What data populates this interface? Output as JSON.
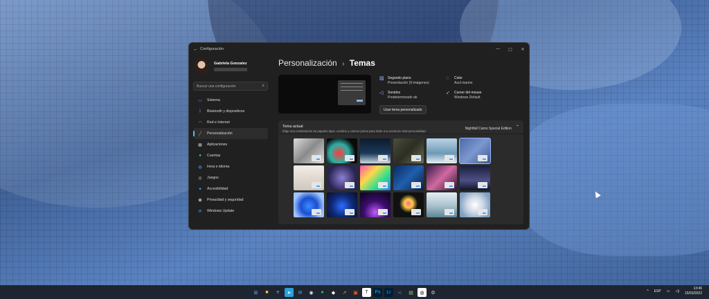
{
  "window": {
    "title": "Configuración",
    "controls": [
      "—",
      "▢",
      "✕"
    ]
  },
  "profile": {
    "name": "Gabriela Gonzalez"
  },
  "search": {
    "placeholder": "Buscar una configuración"
  },
  "sidebar": {
    "items": [
      {
        "label": "Sistema",
        "icon": "monitor-icon",
        "color": "#4aa8ff"
      },
      {
        "label": "Bluetooth y dispositivos",
        "icon": "bluetooth-icon",
        "color": "#4aa8ff"
      },
      {
        "label": "Red e Internet",
        "icon": "wifi-icon",
        "color": "#7aa6ff"
      },
      {
        "label": "Personalización",
        "icon": "brush-icon",
        "color": "#ff8c5a",
        "active": true
      },
      {
        "label": "Aplicaciones",
        "icon": "apps-icon",
        "color": "#c0c0c0"
      },
      {
        "label": "Cuentas",
        "icon": "person-icon",
        "color": "#3fcf8e"
      },
      {
        "label": "Hora e idioma",
        "icon": "globe-icon",
        "color": "#4aa8ff"
      },
      {
        "label": "Juegos",
        "icon": "gamepad-icon",
        "color": "#c0c0c0"
      },
      {
        "label": "Accesibilidad",
        "icon": "accessibility-icon",
        "color": "#4aa8ff"
      },
      {
        "label": "Privacidad y seguridad",
        "icon": "shield-icon",
        "color": "#9aa0a6"
      },
      {
        "label": "Windows Update",
        "icon": "update-icon",
        "color": "#4aa8ff"
      }
    ]
  },
  "breadcrumb": {
    "parent": "Personalización",
    "separator": "›",
    "current": "Temas"
  },
  "properties": {
    "background_title": "Segundo plano",
    "background_value": "Presentación (9 imágenes)",
    "sounds_title": "Sonidos",
    "sounds_value": "Predeterminado de",
    "color_title": "Color",
    "color_value": "Azul marino",
    "cursor_title": "Cursor del mouse",
    "cursor_value": "Windows Default",
    "custom_button": "Usar tema personalizado"
  },
  "theme_section": {
    "title": "Tema actual",
    "description": "Elige una combinación de papeles tapiz, sonidos y colores juntos para darle a tu escritorio más personalidad",
    "current": "Nightfall Camo Special Edition",
    "chevron": "⌃"
  },
  "themes": [
    {
      "bg": "linear-gradient(135deg,#d9d9d9,#8a8a8a 50%,#e0e0e0)"
    },
    {
      "bg": "radial-gradient(circle at 40% 60%,#ff3b3b,#2ab1a6 40%,#0a0a0a 70%)"
    },
    {
      "bg": "linear-gradient(180deg,#0d1b2a,#1b3a5a 60%,#cfd8e3)"
    },
    {
      "bg": "linear-gradient(135deg,#4a4f3a,#2b2e22 50%,#6b6f55)"
    },
    {
      "bg": "linear-gradient(180deg,#b9d3e6,#6e9ab5 60%,#e8eef2)"
    },
    {
      "bg": "linear-gradient(135deg,#4c6aa8,#7d97cf 50%,#3c5a93)",
      "selected": true
    },
    {
      "bg": "linear-gradient(180deg,#f2ede6,#cfc7bd)"
    },
    {
      "bg": "radial-gradient(circle at 50% 50%,#8c7fd6,#2a2450 70%)"
    },
    {
      "bg": "linear-gradient(135deg,#ff4fb0,#ffd84a 35%,#36e08c 65%,#2d7bff)"
    },
    {
      "bg": "linear-gradient(135deg,#0b2a5a,#1f5fae 50%,#0d1f3d)"
    },
    {
      "bg": "linear-gradient(135deg,#3a1a4a,#d06aa0 50%,#2a1538)"
    },
    {
      "bg": "linear-gradient(180deg,#1a1e3a,#4d4f86 60%,#121426)"
    },
    {
      "bg": "radial-gradient(circle at 50% 55%,#3d8bff,#1a4fcf 40%,#9fc4ff 75%)"
    },
    {
      "bg": "radial-gradient(circle at 50% 55%,#2f6bff,#0f2a7a 50%,#070d22)"
    },
    {
      "bg": "radial-gradient(circle at 50% 80%,#c15bff,#3a0d6b 45%,#0a0418)"
    },
    {
      "bg": "radial-gradient(circle at 50% 45%,#ff6a8a,#ffcb4a 20%,#111 45%)"
    },
    {
      "bg": "linear-gradient(180deg,#e6eef3,#a7c0cc 55%,#5d8696)"
    },
    {
      "bg": "radial-gradient(circle at 50% 50%,#ffffff,#cfd9e6 40%,#7fa0c4 80%)"
    }
  ],
  "taskbar": {
    "apps": [
      {
        "icon": "start-icon",
        "glyph": "⊞",
        "bg": "#1f2530",
        "color": "#58a6ff"
      },
      {
        "icon": "explorer-icon",
        "glyph": "■",
        "bg": "#1f2530",
        "color": "#f5c542"
      },
      {
        "icon": "edge-icon",
        "glyph": "e",
        "bg": "#1f2530",
        "color": "#37c0e6"
      },
      {
        "icon": "telegram-icon",
        "glyph": "➤",
        "bg": "#2aa1da",
        "color": "#ffffff"
      },
      {
        "icon": "mail-icon",
        "glyph": "✉",
        "bg": "#1f2530",
        "color": "#4aa8ff"
      },
      {
        "icon": "chrome-icon",
        "glyph": "◉",
        "bg": "#1f2530",
        "color": "#e0e0e0"
      },
      {
        "icon": "spotify-icon",
        "glyph": "●",
        "bg": "#1f2530",
        "color": "#1ed760"
      },
      {
        "icon": "tidal-icon",
        "glyph": "◆",
        "bg": "#1f2530",
        "color": "#ffffff"
      },
      {
        "icon": "arrow-icon",
        "glyph": "↗",
        "bg": "#1f2530",
        "color": "#ff9933"
      },
      {
        "icon": "office-icon",
        "glyph": "▣",
        "bg": "#1f2530",
        "color": "#f05a28"
      },
      {
        "icon": "typora-icon",
        "glyph": "T",
        "bg": "#ffffff",
        "color": "#222222"
      },
      {
        "icon": "photoshop-icon",
        "glyph": "Ps",
        "bg": "#001e36",
        "color": "#31a8ff"
      },
      {
        "icon": "lightroom-icon",
        "glyph": "Lr",
        "bg": "#001e36",
        "color": "#31a8ff"
      },
      {
        "icon": "vscode-icon",
        "glyph": "≺",
        "bg": "#1f2530",
        "color": "#3aa0f0"
      },
      {
        "icon": "notepad-icon",
        "glyph": "▤",
        "bg": "#1f2530",
        "color": "#9ad27a"
      },
      {
        "icon": "github-icon",
        "glyph": "◍",
        "bg": "#ffffff",
        "color": "#111111"
      },
      {
        "icon": "settings-icon",
        "glyph": "⚙",
        "bg": "#1f2530",
        "color": "#cfcfcf"
      }
    ],
    "tray_chevron": "^",
    "language": "ESP",
    "time": "13:46",
    "date": "15/03/2022"
  }
}
